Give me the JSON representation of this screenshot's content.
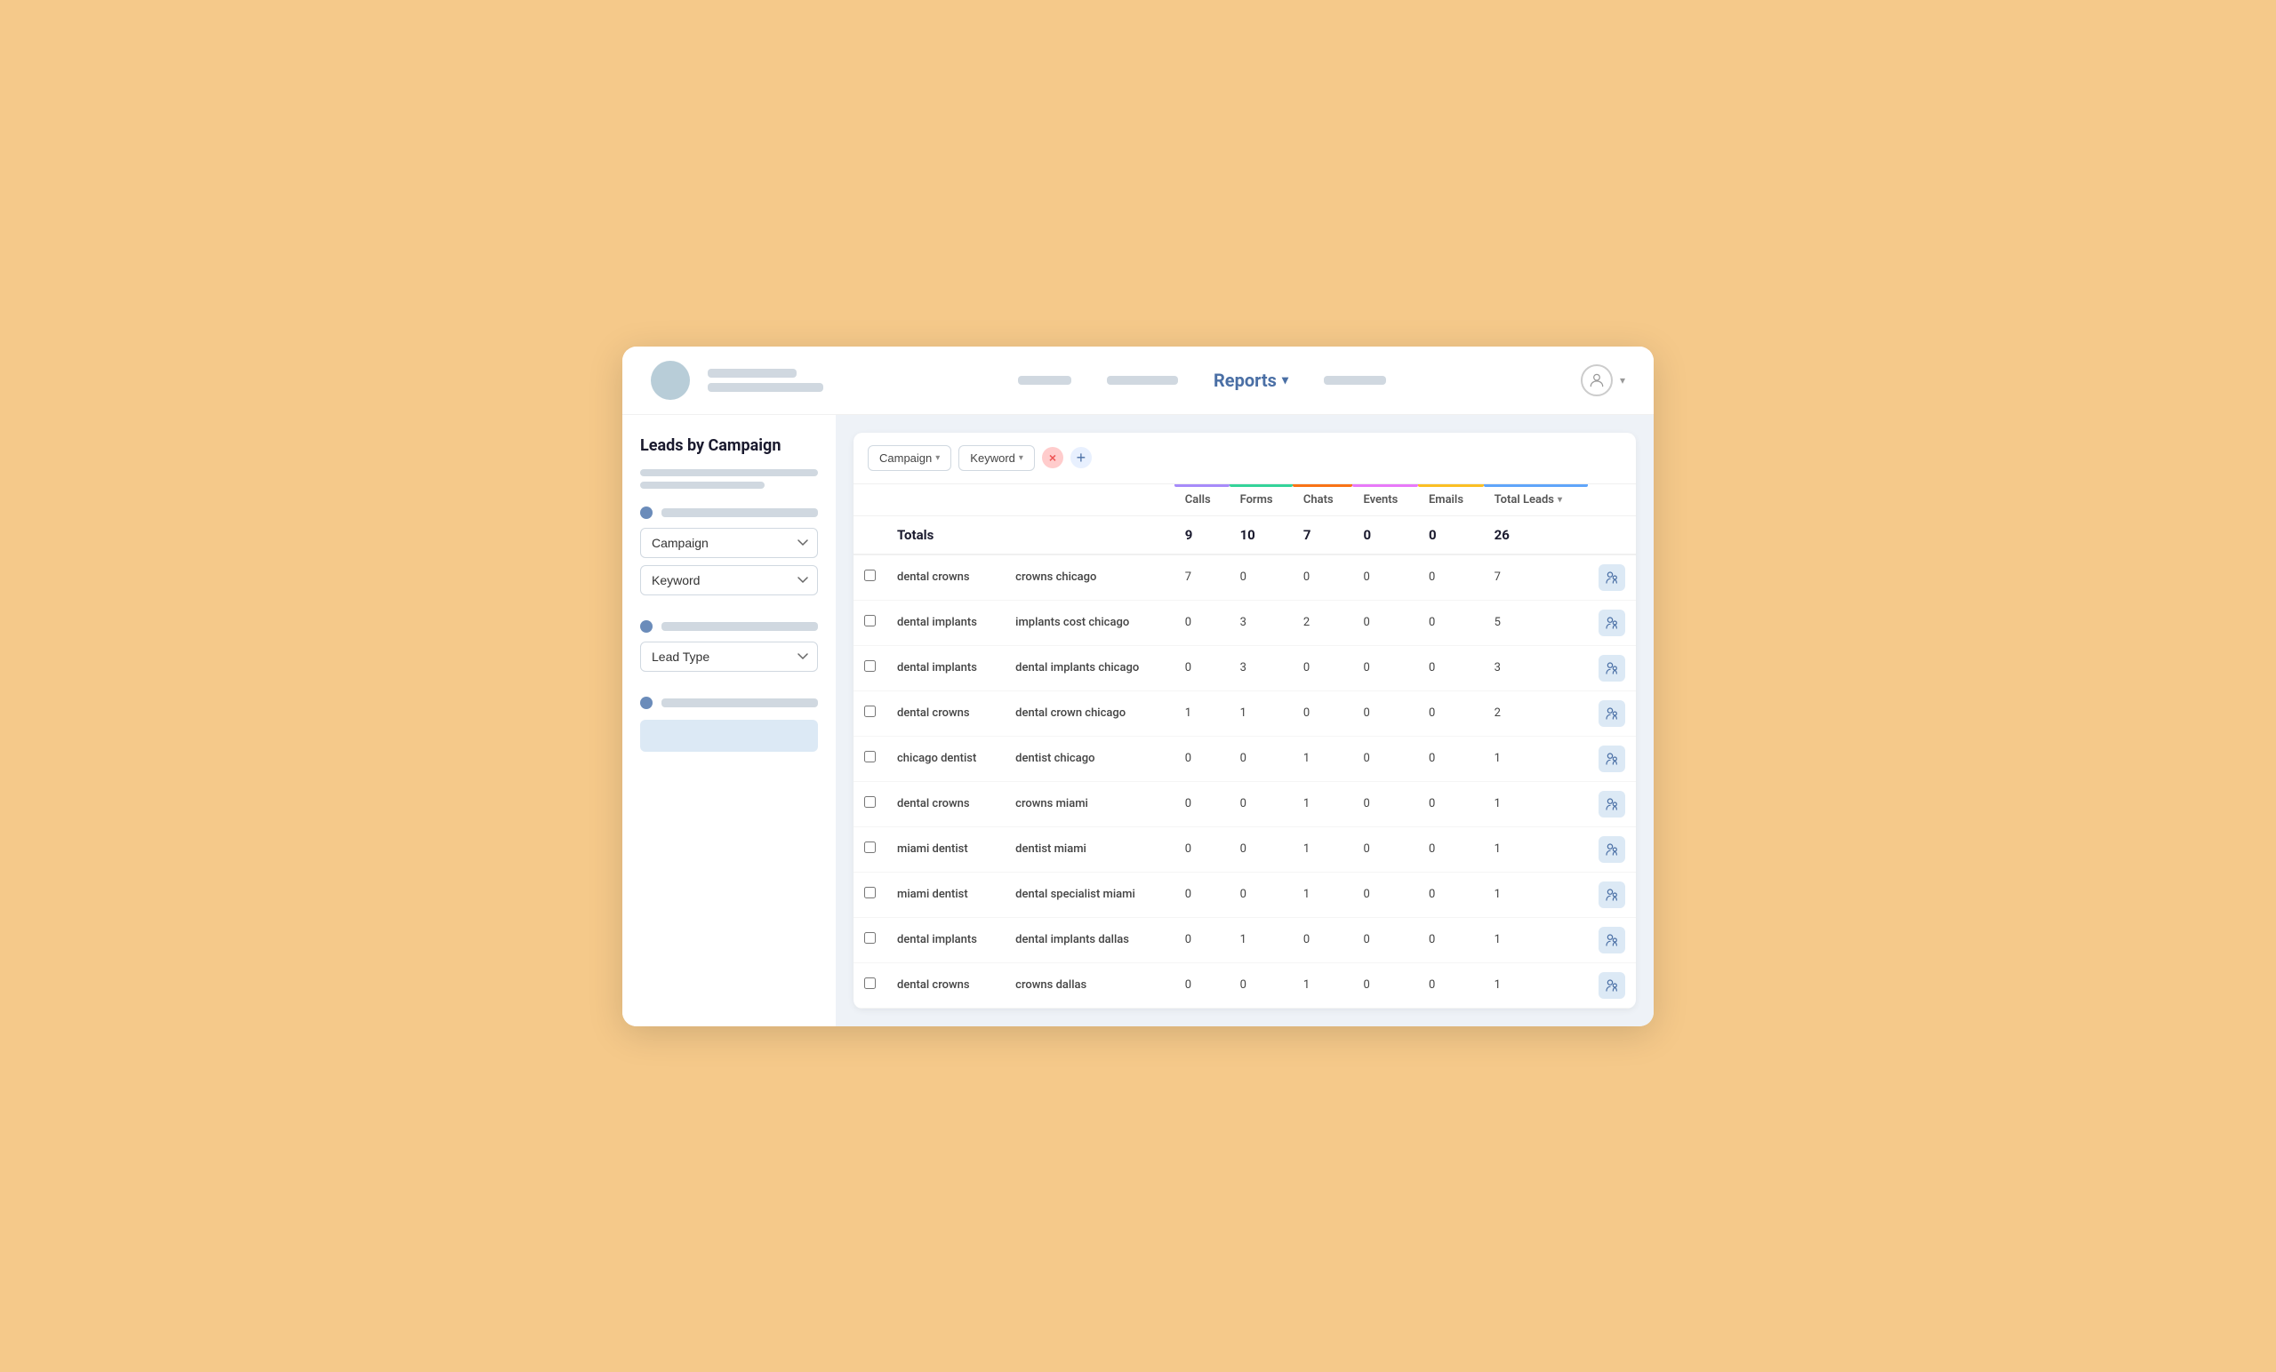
{
  "header": {
    "title": "Reports",
    "title_caret": "▾",
    "user_caret": "▾"
  },
  "sidebar": {
    "title": "Leads by Campaign",
    "filter1_label": "Campaign",
    "filter2_label": "Keyword",
    "filter3_label": "Lead Type"
  },
  "filters": {
    "campaign_label": "Campaign",
    "keyword_label": "Keyword",
    "add_label": "+",
    "close_label": "×"
  },
  "table": {
    "columns": {
      "calls": "Calls",
      "forms": "Forms",
      "chats": "Chats",
      "events": "Events",
      "emails": "Emails",
      "total_leads": "Total Leads"
    },
    "totals_label": "Totals",
    "totals": {
      "calls": "9",
      "forms": "10",
      "chats": "7",
      "events": "0",
      "emails": "0",
      "total": "26"
    },
    "rows": [
      {
        "campaign": "dental crowns",
        "keyword": "crowns chicago",
        "calls": "7",
        "forms": "0",
        "chats": "0",
        "events": "0",
        "emails": "0",
        "total": "7"
      },
      {
        "campaign": "dental implants",
        "keyword": "implants cost chicago",
        "calls": "0",
        "forms": "3",
        "chats": "2",
        "events": "0",
        "emails": "0",
        "total": "5"
      },
      {
        "campaign": "dental implants",
        "keyword": "dental implants chicago",
        "calls": "0",
        "forms": "3",
        "chats": "0",
        "events": "0",
        "emails": "0",
        "total": "3"
      },
      {
        "campaign": "dental crowns",
        "keyword": "dental crown chicago",
        "calls": "1",
        "forms": "1",
        "chats": "0",
        "events": "0",
        "emails": "0",
        "total": "2"
      },
      {
        "campaign": "chicago dentist",
        "keyword": "dentist chicago",
        "calls": "0",
        "forms": "0",
        "chats": "1",
        "events": "0",
        "emails": "0",
        "total": "1"
      },
      {
        "campaign": "dental crowns",
        "keyword": "crowns miami",
        "calls": "0",
        "forms": "0",
        "chats": "1",
        "events": "0",
        "emails": "0",
        "total": "1"
      },
      {
        "campaign": "miami dentist",
        "keyword": "dentist miami",
        "calls": "0",
        "forms": "0",
        "chats": "1",
        "events": "0",
        "emails": "0",
        "total": "1"
      },
      {
        "campaign": "miami dentist",
        "keyword": "dental specialist miami",
        "calls": "0",
        "forms": "0",
        "chats": "1",
        "events": "0",
        "emails": "0",
        "total": "1"
      },
      {
        "campaign": "dental implants",
        "keyword": "dental implants dallas",
        "calls": "0",
        "forms": "1",
        "chats": "0",
        "events": "0",
        "emails": "0",
        "total": "1"
      },
      {
        "campaign": "dental crowns",
        "keyword": "crowns dallas",
        "calls": "0",
        "forms": "0",
        "chats": "1",
        "events": "0",
        "emails": "0",
        "total": "1"
      }
    ]
  }
}
